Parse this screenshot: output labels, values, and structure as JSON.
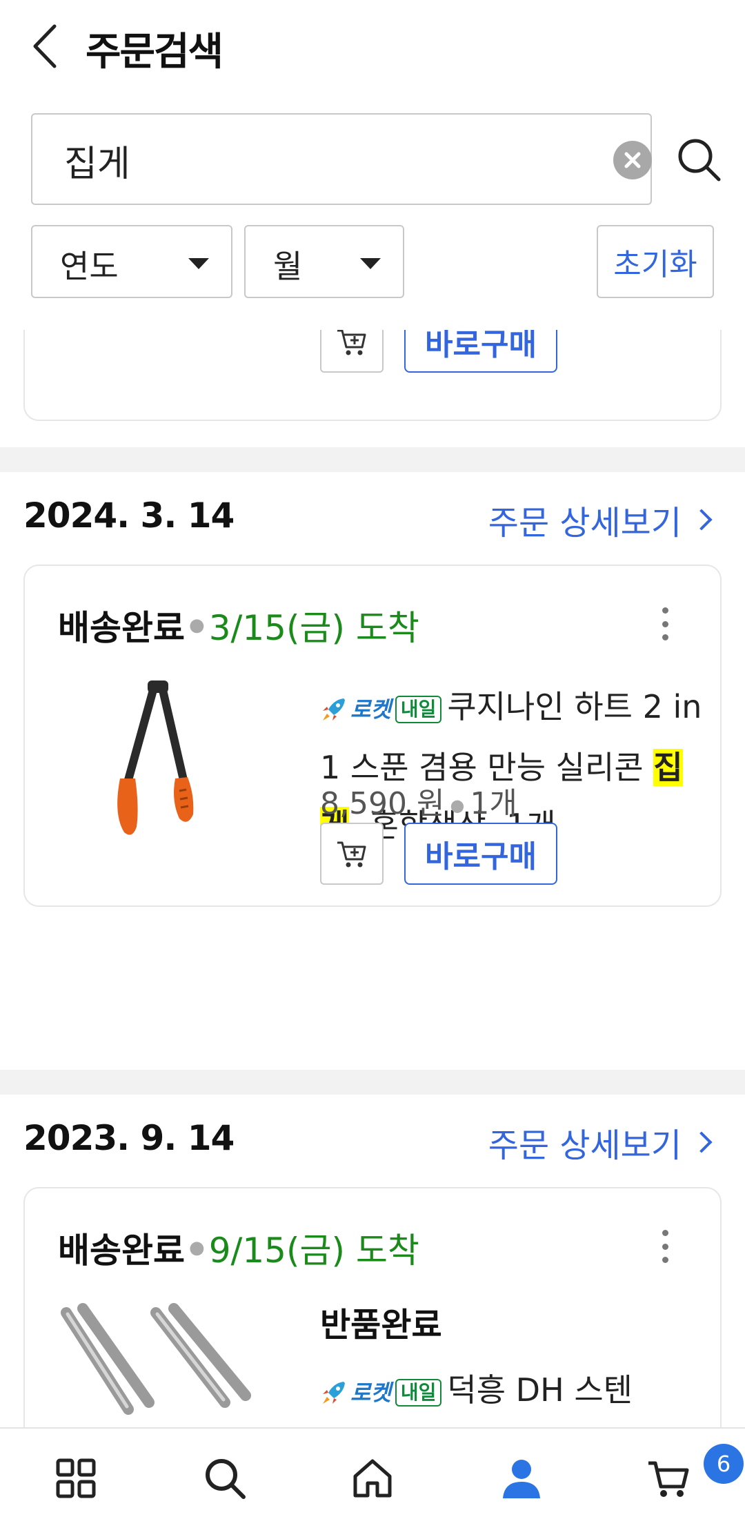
{
  "header": {
    "title": "주문검색"
  },
  "search": {
    "value": "집게"
  },
  "filters": {
    "year_label": "연도",
    "month_label": "월",
    "reset_label": "초기화"
  },
  "partial_card": {
    "buy_label": "바로구매"
  },
  "orders": [
    {
      "date": "2024. 3. 14",
      "detail_label": "주문 상세보기",
      "status": "배송완료",
      "arrival": "3/15(금) 도착",
      "badges": {
        "rocket": "로켓",
        "tomorrow": "내일"
      },
      "product": {
        "name_before": "쿠지나인 하트 2 in 1 스푼 겸용 만능 실리콘 ",
        "name_highlight": "집게",
        "name_after": ", 혼합색상, 1개"
      },
      "price": "8,590 원",
      "quantity": "1개",
      "buy_label": "바로구매"
    },
    {
      "date": "2023. 9. 14",
      "detail_label": "주문 상세보기",
      "status": "배송완료",
      "arrival": "9/15(금) 도착",
      "return_status": "반품완료",
      "badges": {
        "rocket": "로켓",
        "tomorrow": "내일"
      },
      "product": {
        "name_partial": "덕흥 DH 스텐"
      }
    }
  ],
  "bottom_nav": {
    "cart_count": "6"
  },
  "colors": {
    "accent_blue": "#3366dd",
    "arrival_green": "#1a8a1a",
    "highlight": "#ffff00",
    "badge_blue": "#2b74e4"
  },
  "icons": [
    "back-icon",
    "clear-icon",
    "search-icon",
    "caret-down-icon",
    "chevron-right-icon",
    "kebab-icon",
    "rocket-icon",
    "add-to-cart-icon",
    "grid-icon",
    "home-icon",
    "user-icon",
    "cart-icon"
  ]
}
